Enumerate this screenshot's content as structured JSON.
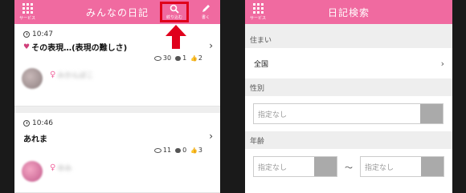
{
  "left": {
    "header": {
      "service_label": "サービス",
      "title": "みんなの日記",
      "filter_label": "絞り込む",
      "write_label": "書く"
    },
    "entries": [
      {
        "time": "10:47",
        "title": "その表現…(表現の難しさ)",
        "views": "30",
        "comments": "1",
        "likes": "2",
        "author": "みかんぼこ"
      },
      {
        "time": "10:46",
        "title": "あれま",
        "views": "11",
        "comments": "0",
        "likes": "3",
        "author": "ゆみ"
      }
    ]
  },
  "right": {
    "header": {
      "service_label": "サービス",
      "title": "日記検索"
    },
    "sections": {
      "residence": {
        "label": "住まい",
        "value": "全国"
      },
      "gender": {
        "label": "性別",
        "placeholder": "指定なし"
      },
      "age": {
        "label": "年齢",
        "from_placeholder": "指定なし",
        "tilde": "〜",
        "to_placeholder": "指定なし"
      }
    }
  },
  "colors": {
    "brand_pink": "#f06aa0",
    "highlight_red": "#e0001b"
  }
}
